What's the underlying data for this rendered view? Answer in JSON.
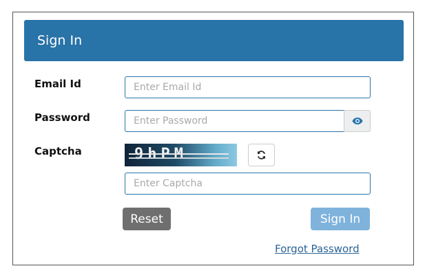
{
  "header": {
    "title": "Sign In"
  },
  "form": {
    "email": {
      "label": "Email Id",
      "placeholder": "Enter Email Id",
      "value": ""
    },
    "password": {
      "label": "Password",
      "placeholder": "Enter Password",
      "value": "",
      "toggle_icon": "eye-icon"
    },
    "captcha": {
      "label": "Captcha",
      "image_text": "9hPM",
      "refresh_icon": "refresh-icon",
      "placeholder": "Enter Captcha",
      "value": ""
    }
  },
  "actions": {
    "reset_label": "Reset",
    "signin_label": "Sign In",
    "forgot_label": "Forgot Password"
  },
  "colors": {
    "primary": "#2873a8",
    "signin_button": "#7fb3dc",
    "reset_button": "#6f6f6f",
    "link": "#2a6496"
  }
}
